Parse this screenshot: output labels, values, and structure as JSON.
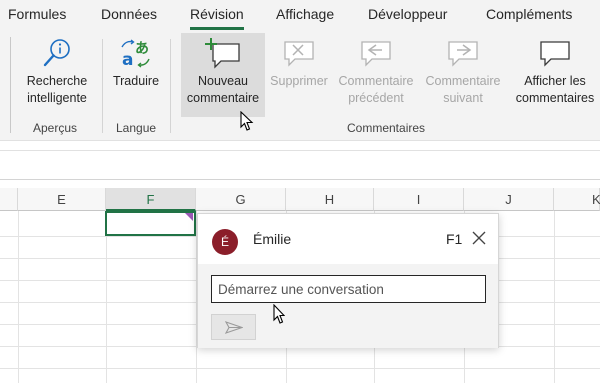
{
  "tabs": [
    {
      "label": "Formules"
    },
    {
      "label": "Données"
    },
    {
      "label": "Révision"
    },
    {
      "label": "Affichage"
    },
    {
      "label": "Développeur"
    },
    {
      "label": "Compléments"
    }
  ],
  "ribbon": {
    "buttons": {
      "recherche": {
        "line1": "Recherche",
        "line2": "intelligente"
      },
      "traduire": {
        "line1": "Traduire"
      },
      "nouveau": {
        "line1": "Nouveau",
        "line2": "commentaire"
      },
      "supprimer": {
        "line1": "Supprimer"
      },
      "precedent": {
        "line1": "Commentaire",
        "line2": "précédent"
      },
      "suivant": {
        "line1": "Commentaire",
        "line2": "suivant"
      },
      "afficher": {
        "line1": "Afficher les",
        "line2": "commentaires"
      }
    },
    "groups": {
      "apercus": "Aperçus",
      "langue": "Langue",
      "commentaires": "Commentaires"
    }
  },
  "columns": [
    "E",
    "F",
    "G",
    "H",
    "I",
    "J",
    "K"
  ],
  "selected_column": "F",
  "comment_card": {
    "avatar_initial": "É",
    "author": "Émilie",
    "cell_ref": "F1",
    "input_placeholder": "Démarrez une conversation"
  },
  "colors": {
    "accent_green": "#217346",
    "avatar_bg": "#8b1e2a",
    "comment_flag": "#9b59b6",
    "translate_blue": "#1e6fc2",
    "translate_green": "#2e8b3a"
  }
}
